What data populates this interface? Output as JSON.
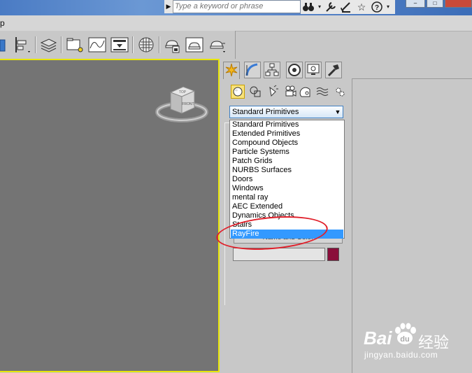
{
  "search": {
    "placeholder": "Type a keyword or phrase"
  },
  "title_icons": [
    "binoculars-icon",
    "wrench-icon",
    "satellite-icon",
    "star-icon",
    "help-icon"
  ],
  "menu": {
    "partial_item": "p"
  },
  "viewcube": {
    "top_label": "TOP",
    "front_label": "FRONT"
  },
  "command_panel": {
    "tabs": [
      "create-tab",
      "modify-tab",
      "hierarchy-tab",
      "motion-tab",
      "display-tab",
      "utilities-tab"
    ],
    "active_tab": "create-tab",
    "categories": [
      "geometry",
      "shapes",
      "lights",
      "cameras",
      "helpers",
      "space-warps",
      "systems"
    ],
    "active_category": "geometry",
    "dropdown": {
      "selected": "Standard Primitives",
      "options": [
        "Standard Primitives",
        "Extended Primitives",
        "Compound Objects",
        "Particle Systems",
        "Patch Grids",
        "NURBS Surfaces",
        "Doors",
        "Windows",
        "mental ray",
        "AEC Extended",
        "Dynamics Objects",
        "Stairs",
        "RayFire"
      ],
      "highlighted": "RayFire"
    },
    "name_and_color_label": "Name and Color",
    "swatch_color": "#8a0e3a"
  },
  "colors": {
    "viewport_border": "#e8e60a",
    "highlight": "#3399ff",
    "annotation": "#e01f2a"
  },
  "watermark": {
    "brand_main": "Bai",
    "brand_paw": "du",
    "brand_cn": "经验",
    "url": "jingyan.baidu.com"
  }
}
